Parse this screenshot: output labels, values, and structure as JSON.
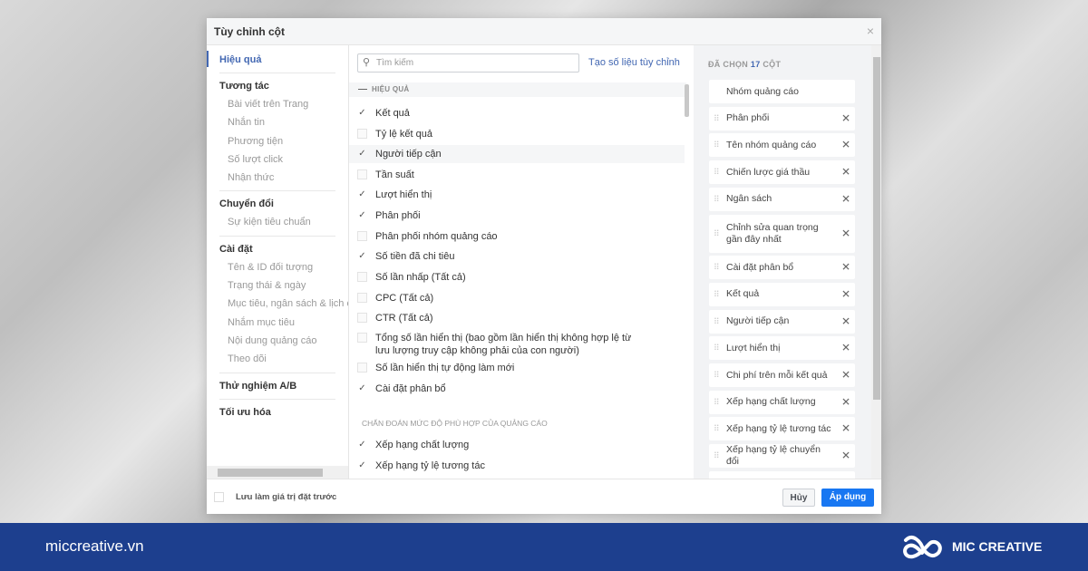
{
  "dialog": {
    "title": "Tùy chỉnh cột",
    "close": "×"
  },
  "nav": [
    {
      "label": "Hiệu quả",
      "active": true,
      "sub": []
    },
    {
      "label": "Tương tác",
      "sub": [
        "Bài viết trên Trang",
        "Nhắn tin",
        "Phương tiện",
        "Số lượt click",
        "Nhận thức"
      ]
    },
    {
      "label": "Chuyển đổi",
      "sub": [
        "Sự kiện tiêu chuẩn"
      ]
    },
    {
      "label": "Cài đặt",
      "sub": [
        "Tên & ID đối tượng",
        "Trạng thái & ngày",
        "Mục tiêu, ngân sách & lịch c",
        "Nhắm mục tiêu",
        "Nội dung quảng cáo",
        "Theo dõi"
      ]
    },
    {
      "label": "Thử nghiệm A/B",
      "sub": []
    },
    {
      "label": "Tối ưu hóa",
      "sub": []
    }
  ],
  "search": {
    "placeholder": "Tìm kiếm",
    "icon": "search-icon"
  },
  "custom_metric_link": "Tạo số liệu tùy chỉnh",
  "section_title": "HIỆU QUẢ",
  "metrics": [
    {
      "label": "Kết quả",
      "checked": true
    },
    {
      "label": "Tỷ lệ kết quả",
      "checked": false
    },
    {
      "label": "Người tiếp cận",
      "checked": true
    },
    {
      "label": "Tần suất",
      "checked": false
    },
    {
      "label": "Lượt hiển thị",
      "checked": true
    },
    {
      "label": "Phân phối",
      "checked": true
    },
    {
      "label": "Phân phối nhóm quảng cáo",
      "checked": false
    },
    {
      "label": "Số tiền đã chi tiêu",
      "checked": true
    },
    {
      "label": "Số lần nhấp (Tất cả)",
      "checked": false
    },
    {
      "label": "CPC (Tất cả)",
      "checked": false
    },
    {
      "label": "CTR (Tất cả)",
      "checked": false
    },
    {
      "label": "Tổng số lần hiển thị (bao gồm lần hiển thị không hợp lệ từ lưu lượng truy cập không phải của con người)",
      "checked": false
    },
    {
      "label": "Số lần hiển thị tự động làm mới",
      "checked": false
    },
    {
      "label": "Cài đặt phân bổ",
      "checked": true
    }
  ],
  "diagnostics_title": "CHẨN ĐOÁN MỨC ĐỘ PHÙ HỢP CỦA QUẢNG CÁO",
  "diagnostics": [
    {
      "label": "Xếp hạng chất lượng",
      "checked": true
    },
    {
      "label": "Xếp hạng tỷ lệ tương tác",
      "checked": true
    }
  ],
  "selected": {
    "prefix": "ĐÃ CHỌN",
    "count": "17",
    "suffix": "CỘT",
    "items": [
      "Nhóm quảng cáo",
      "Phân phối",
      "Tên nhóm quảng cáo",
      "Chiến lược giá thầu",
      "Ngân sách",
      "Chỉnh sửa quan trọng gần đây nhất",
      "Cài đặt phân bổ",
      "Kết quả",
      "Người tiếp cận",
      "Lượt hiển thị",
      "Chi phí trên mỗi kết quả",
      "Xếp hạng chất lượng",
      "Xếp hạng tỷ lệ tương tác",
      "Xếp hạng tỷ lệ chuyển đổi"
    ]
  },
  "footer": {
    "save_preset": "Lưu làm giá trị đặt trước",
    "cancel": "Hủy",
    "apply": "Áp dụng"
  },
  "banner": {
    "site": "miccreative.vn",
    "brand": "MIC CREATIVE",
    "color": "#1d3f8e"
  }
}
